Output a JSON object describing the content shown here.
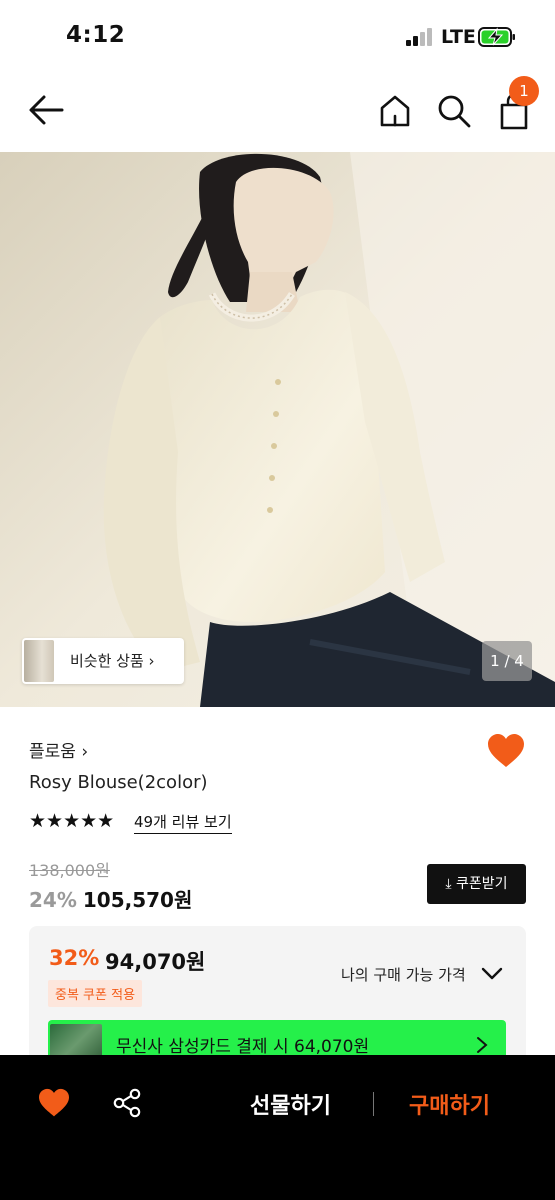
{
  "status_bar": {
    "time": "4:12",
    "network": "LTE"
  },
  "header": {
    "cart_count": "1"
  },
  "gallery": {
    "similar_label": "비슷한 상품 ›",
    "counter": "1 / 4"
  },
  "product": {
    "brand": "플로움 ›",
    "name": "Rosy Blouse(2color)",
    "stars": "★★★★★",
    "rating": 5,
    "review_link": "49개 리뷰 보기",
    "original_price": "138,000원",
    "discount_pct": "24%",
    "sale_price": "105,570원",
    "coupon_button": "⤓ 쿠폰받기"
  },
  "my_price": {
    "pct": "32%",
    "price": "94,070원",
    "chip": "중복 쿠폰 적용",
    "label": "나의 구매 가능 가격",
    "card_promo": "무신사 삼성카드 결제 시 64,070원"
  },
  "bottom_bar": {
    "gift": "선물하기",
    "buy": "구매하기"
  },
  "colors": {
    "accent": "#f25c19",
    "promo_green": "#25f04a",
    "bottom_bg": "#000000"
  },
  "icons": [
    "back-arrow-icon",
    "home-icon",
    "search-icon",
    "cart-icon",
    "heart-icon",
    "share-icon",
    "chevron-down-icon",
    "chevron-right-icon",
    "download-icon",
    "star-icon"
  ]
}
